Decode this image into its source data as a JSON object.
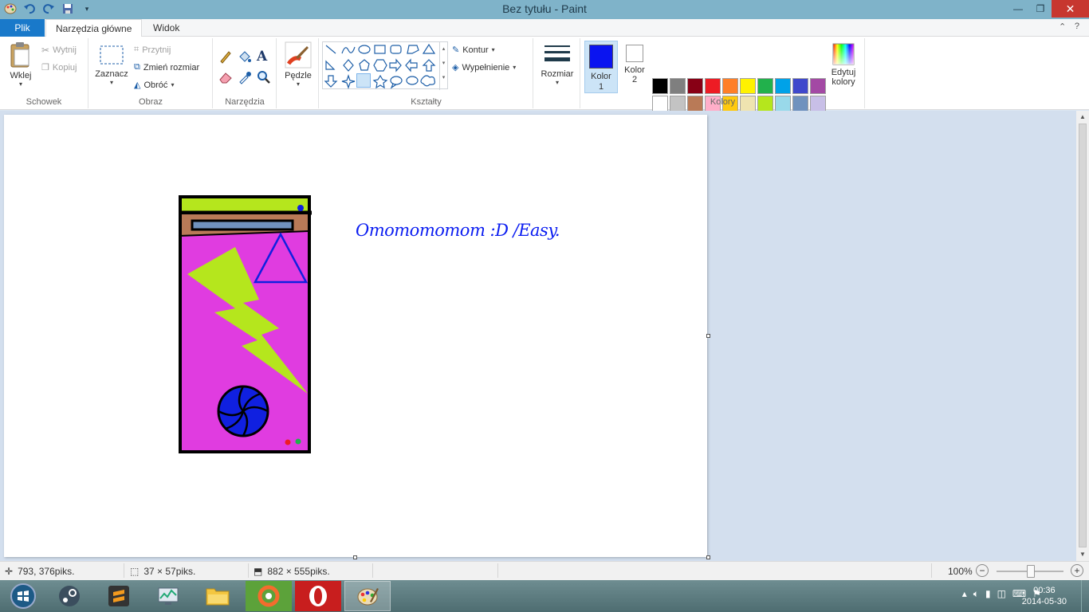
{
  "window": {
    "title": "Bez tytułu - Paint"
  },
  "tabs": {
    "file": "Plik",
    "home": "Narzędzia główne",
    "view": "Widok"
  },
  "clipboard": {
    "paste": "Wklej",
    "cut": "Wytnij",
    "copy": "Kopiuj",
    "label": "Schowek"
  },
  "image": {
    "select": "Zaznacz",
    "crop": "Przytnij",
    "resize": "Zmień rozmiar",
    "rotate": "Obróć",
    "label": "Obraz"
  },
  "tools": {
    "label": "Narzędzia"
  },
  "brushes": {
    "label": "Pędzle"
  },
  "shapes": {
    "outline": "Kontur",
    "fill": "Wypełnienie",
    "label": "Kształty"
  },
  "size": {
    "label": "Rozmiar"
  },
  "colors": {
    "color1_label": "Kolor",
    "color1_num": "1",
    "color2_label": "Kolor",
    "color2_num": "2",
    "edit_label_1": "Edytuj",
    "edit_label_2": "kolory",
    "label": "Kolory",
    "color1": "#0a14f0",
    "color2": "#ffffff",
    "palette": [
      "#000000",
      "#7f7f7f",
      "#880015",
      "#ed1c24",
      "#ff7f27",
      "#fff200",
      "#22b14c",
      "#00a2e8",
      "#3f48cc",
      "#a349a4",
      "#ffffff",
      "#c3c3c3",
      "#b97a57",
      "#ffaec9",
      "#ffc90e",
      "#efe4b0",
      "#b5e61d",
      "#99d9ea",
      "#7092be",
      "#c8bfe7",
      "#e03ce0",
      "#0a14f0",
      "#ffffff",
      "#ffffff",
      "#ffffff",
      "#ffffff",
      "#ffffff",
      "#ffffff",
      "#ffffff",
      "#ffffff"
    ]
  },
  "canvas": {
    "text": "Omomomomom :D /Easy."
  },
  "status": {
    "cursor": "793, 376piks.",
    "selection": "37 × 57piks.",
    "image_size": "882 × 555piks.",
    "zoom": "100%"
  },
  "taskbar": {
    "time": "00:36",
    "date": "2014-05-30"
  }
}
